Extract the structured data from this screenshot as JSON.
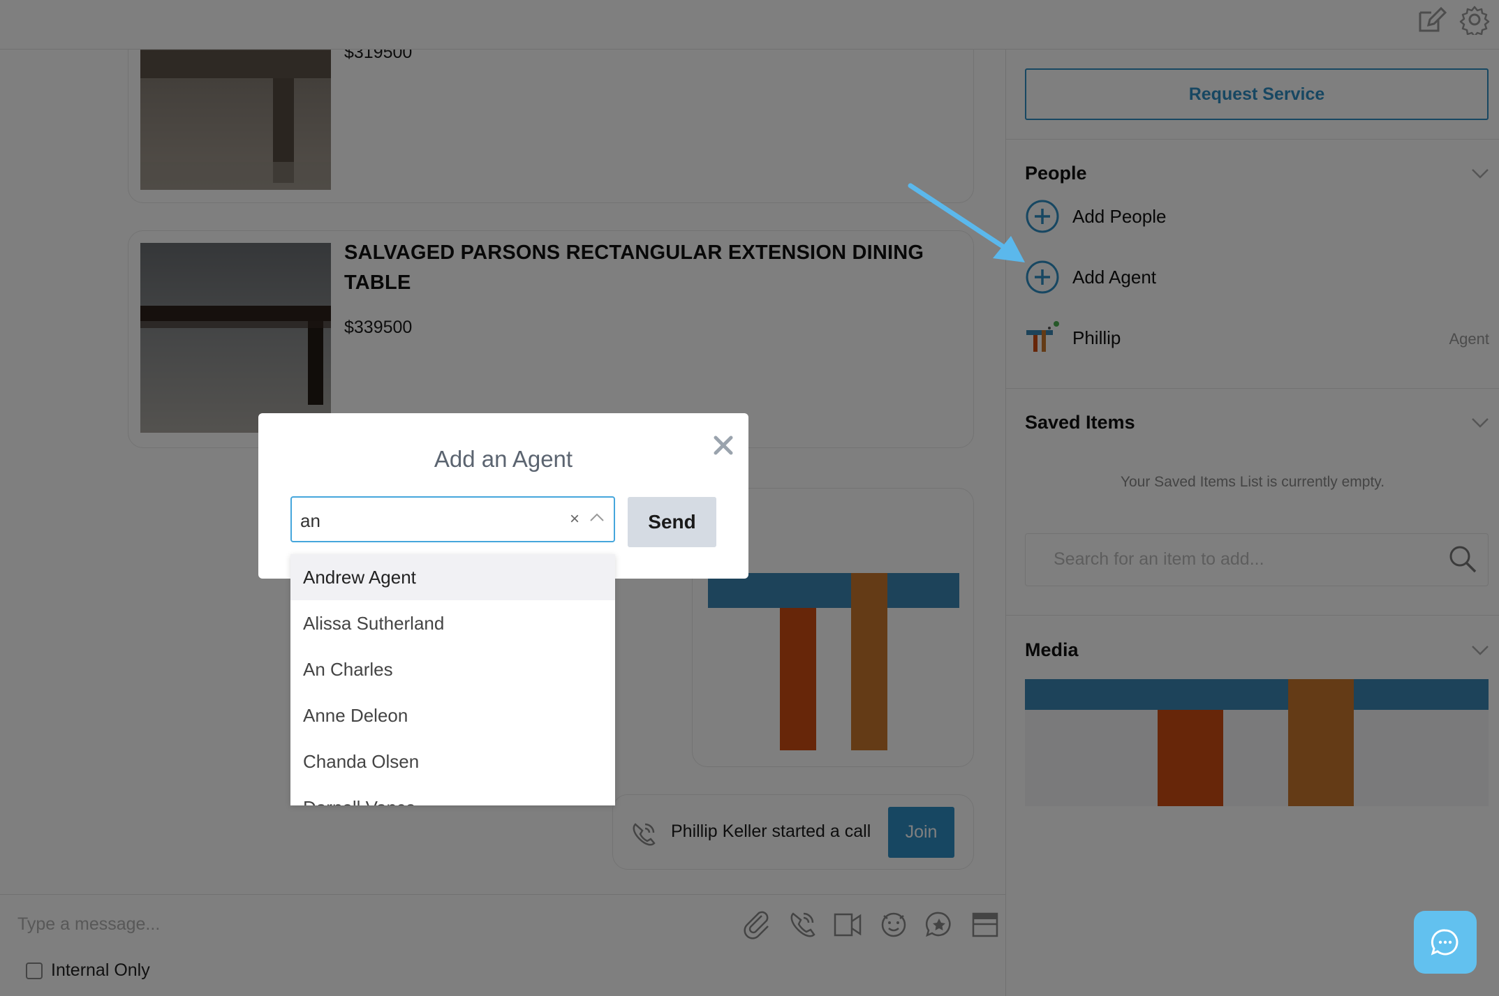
{
  "toolbar": {
    "icons": [
      "edit-icon",
      "gear-icon"
    ]
  },
  "chat": {
    "products": [
      {
        "title": "",
        "price": "$319500"
      },
      {
        "title": "SALVAGED PARSONS RECTANGULAR EXTENSION DINING TABLE",
        "price": "$339500"
      }
    ],
    "call_notice": {
      "text": "Phillip Keller started a call",
      "join_label": "Join"
    }
  },
  "composer": {
    "placeholder": "Type a message...",
    "icons": [
      "paperclip-icon",
      "phone-icon",
      "video-icon",
      "emoji-icon",
      "star-chat-icon",
      "archive-icon"
    ],
    "internal_only_label": "Internal Only",
    "internal_only_checked": false
  },
  "sidebar": {
    "request_service_label": "Request Service",
    "people": {
      "heading": "People",
      "add_people_label": "Add People",
      "add_agent_label": "Add Agent",
      "members": [
        {
          "name": "Phillip",
          "role": "Agent",
          "online": true
        }
      ]
    },
    "saved_items": {
      "heading": "Saved Items",
      "empty_text": "Your Saved Items List is currently empty.",
      "search_placeholder": "Search for an item to add..."
    },
    "media": {
      "heading": "Media"
    }
  },
  "modal": {
    "title": "Add an Agent",
    "input_value": "an",
    "send_label": "Send",
    "options": [
      "Andrew Agent",
      "Alissa Sutherland",
      "An Charles",
      "Anne Deleon",
      "Chanda Olsen",
      "Darnell Vance"
    ],
    "highlighted_option": "Andrew Agent"
  },
  "colors": {
    "accent": "#2e8ec4",
    "input_focus": "#45a6dc",
    "send_bg": "#d5dbe3",
    "fab_bg": "#62c1ef",
    "annotation_arrow": "#5bb8ec",
    "logo_blue": "#3a86b4",
    "logo_orange": "#cf4c12",
    "logo_brown": "#c9762c"
  }
}
